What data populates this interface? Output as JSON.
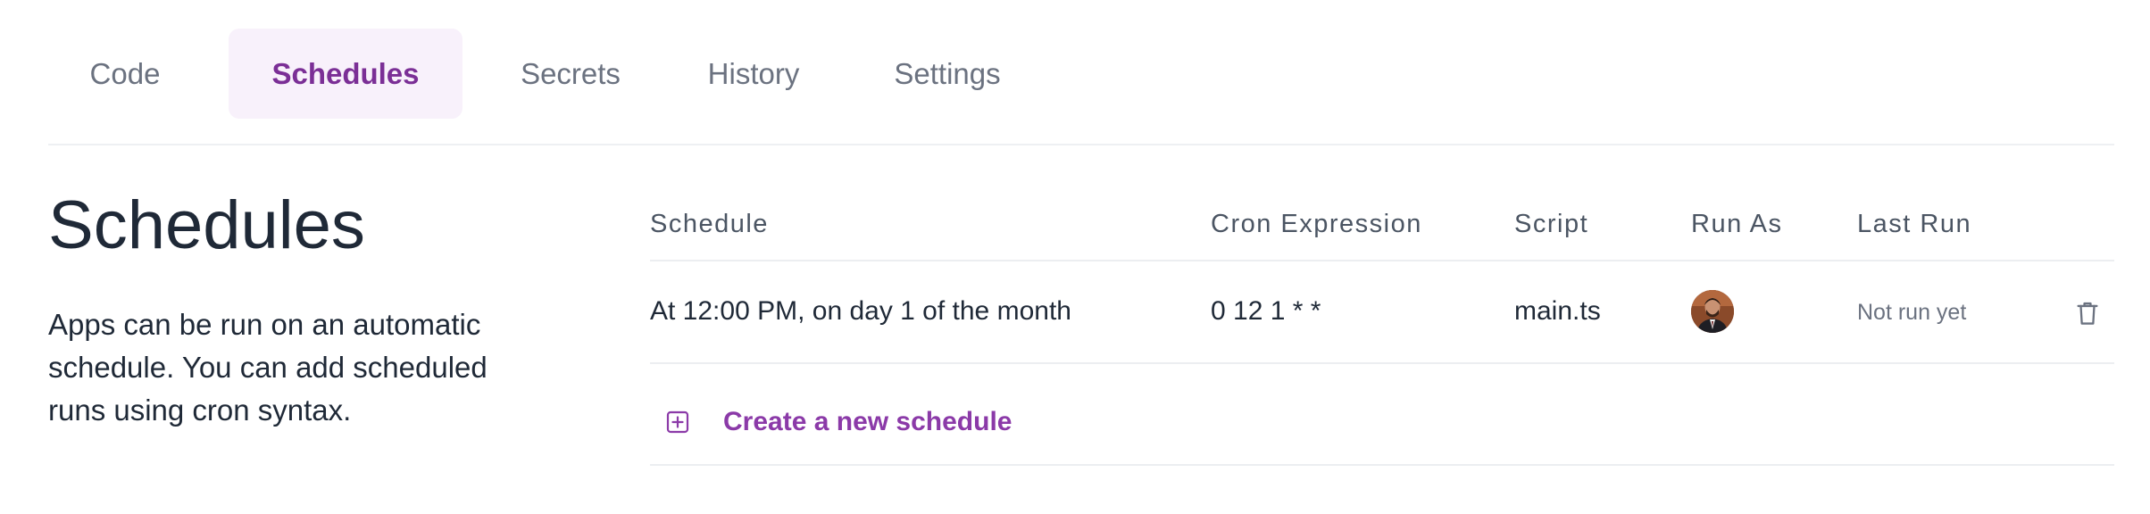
{
  "tabs": [
    {
      "label": "Code",
      "active": false
    },
    {
      "label": "Schedules",
      "active": true
    },
    {
      "label": "Secrets",
      "active": false
    },
    {
      "label": "History",
      "active": false
    },
    {
      "label": "Settings",
      "active": false
    }
  ],
  "page": {
    "title": "Schedules",
    "description": "Apps can be run on an automatic schedule. You can add scheduled runs using cron syntax."
  },
  "table": {
    "headers": {
      "schedule": "Schedule",
      "cron": "Cron Expression",
      "script": "Script",
      "run_as": "Run As",
      "last_run": "Last Run"
    },
    "rows": [
      {
        "schedule": "At 12:00 PM, on day 1 of the month",
        "cron": "0 12 1 * *",
        "script": "main.ts",
        "run_as_icon": "avatar",
        "last_run": "Not run yet",
        "action_icon": "trash-icon"
      }
    ],
    "create_label": "Create a new schedule",
    "create_icon": "plus-square-icon"
  },
  "colors": {
    "accent": "#8b3aa8",
    "active_tab_bg": "#f8f1fb",
    "text_primary": "#1f2937",
    "text_muted": "#6b7280",
    "divider": "#eceef1"
  }
}
